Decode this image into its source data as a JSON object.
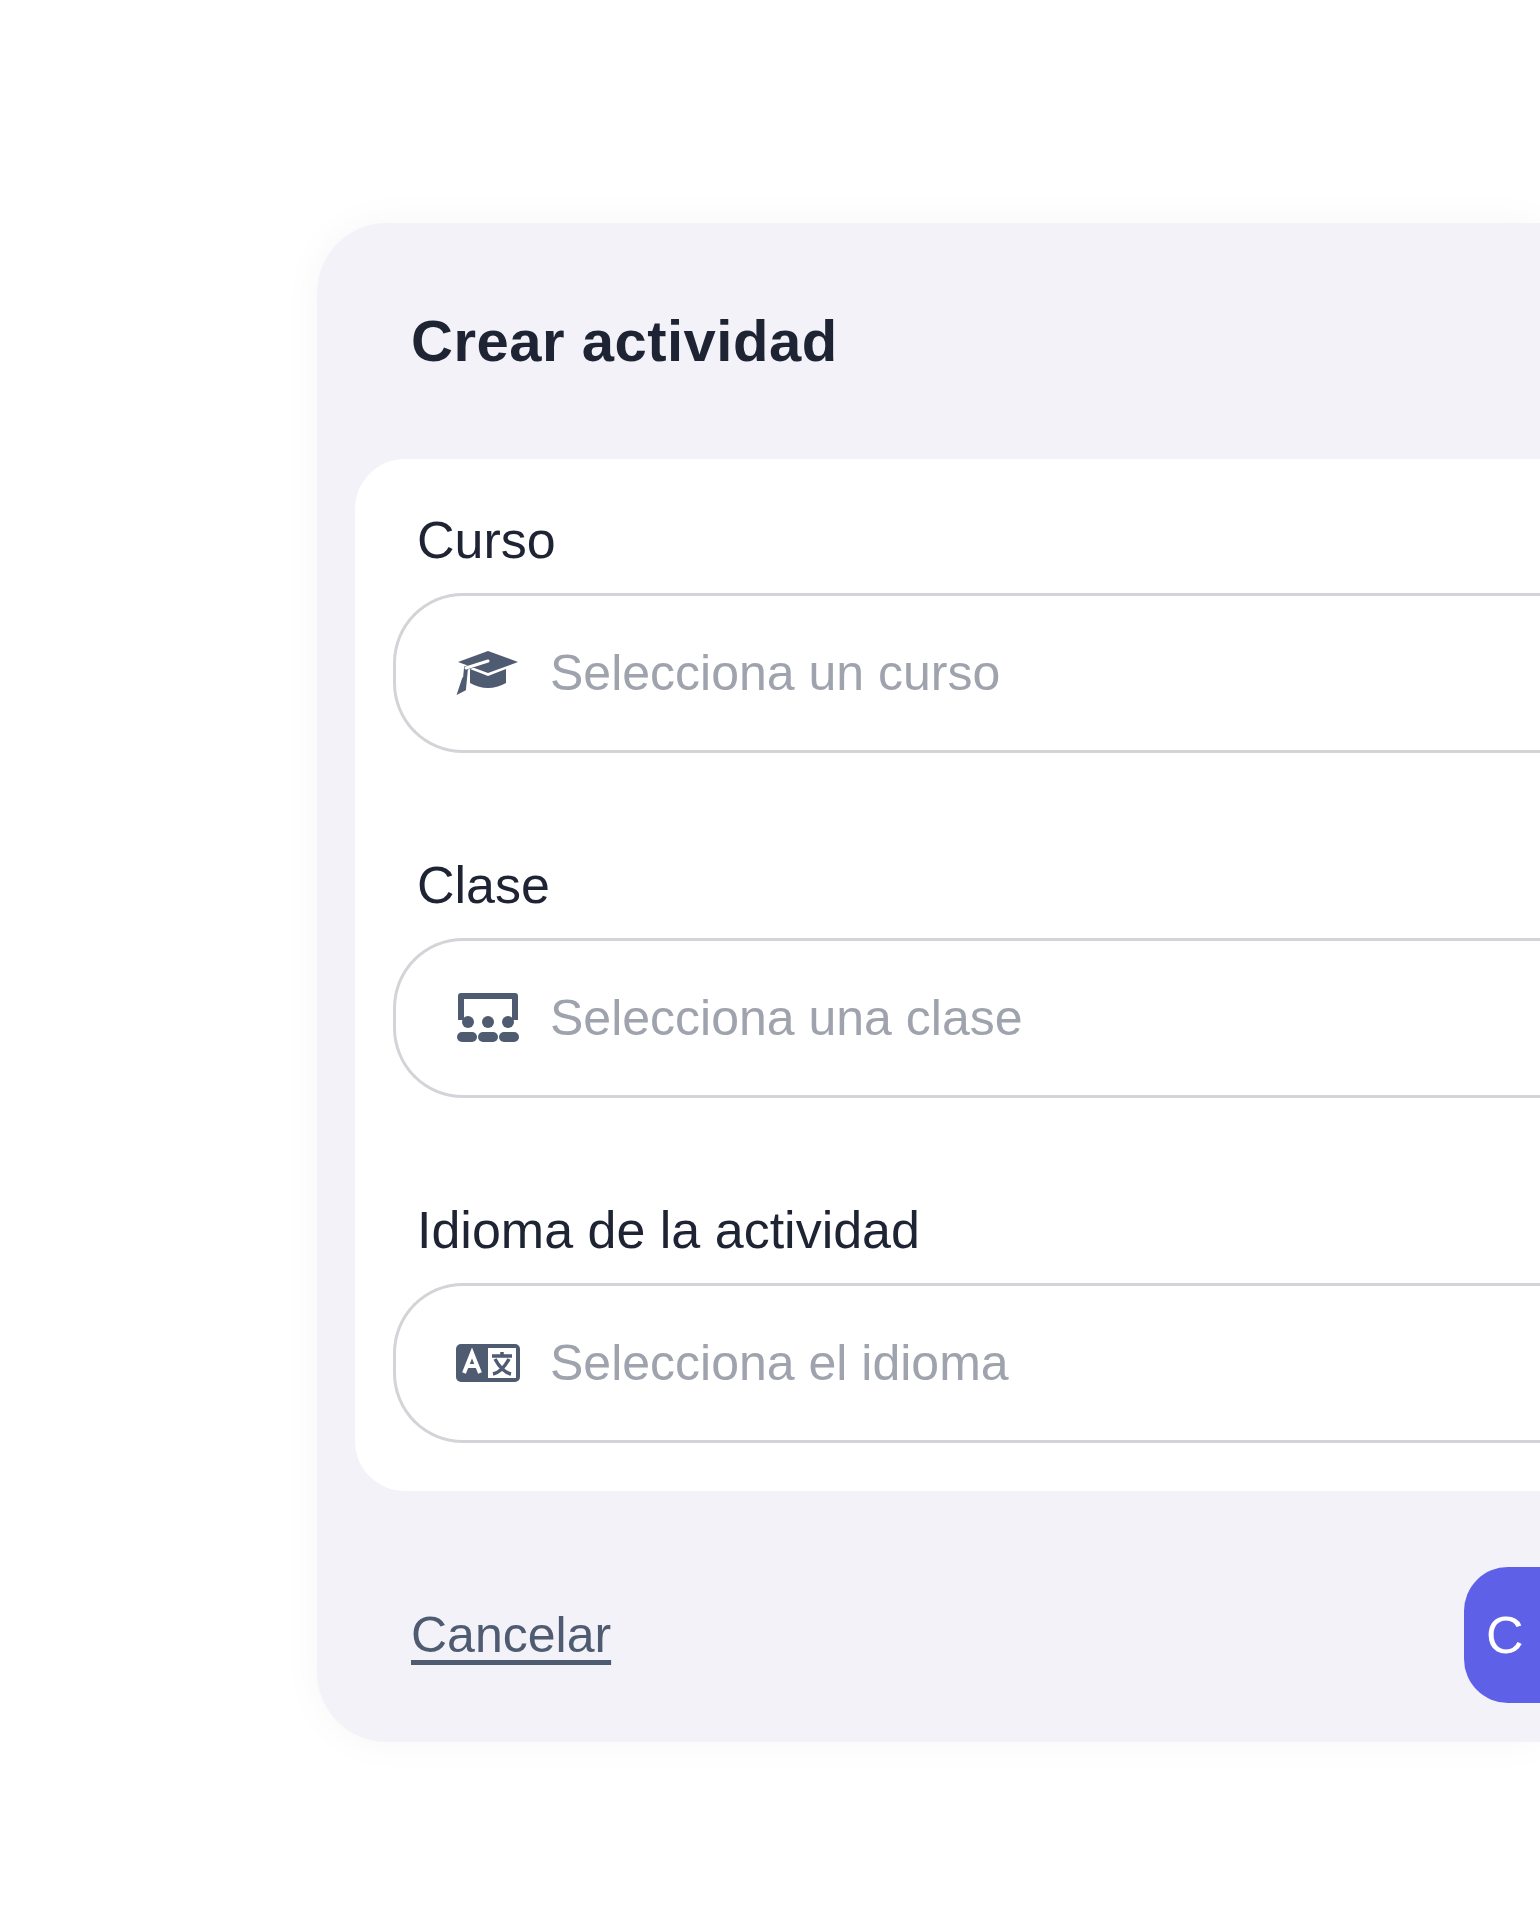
{
  "dialog": {
    "title": "Crear actividad",
    "fields": [
      {
        "label": "Curso",
        "kind": "course",
        "placeholder": "Selecciona un curso"
      },
      {
        "label": "Clase",
        "kind": "class",
        "placeholder": "Selecciona una clase"
      },
      {
        "label": "Idioma de la actividad",
        "kind": "language",
        "placeholder": "Selecciona el idioma"
      }
    ],
    "cancel_link": "Cancelar",
    "primary_button": "C"
  }
}
